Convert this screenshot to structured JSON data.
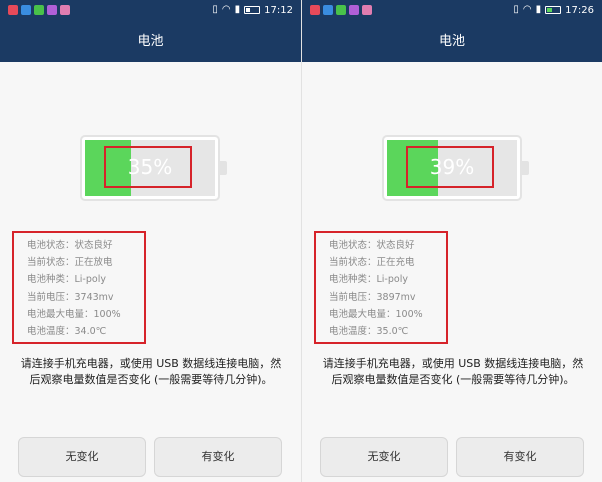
{
  "colors": {
    "header_bg": "#1b3a63",
    "battery_green": "#5bd65b",
    "highlight_red": "#d6232a",
    "app_icons": [
      "#e64a5a",
      "#3a8de0",
      "#49c24a",
      "#b05fd8",
      "#e07db0"
    ]
  },
  "screens": [
    {
      "status_bar": {
        "time": "17:12",
        "battery_level": 0.35,
        "charging": false,
        "icons": [
          "vibrate-icon",
          "wifi-icon",
          "sim-icon",
          "battery-icon"
        ]
      },
      "title": "电池",
      "battery": {
        "percent_label": "35%",
        "level": 0.35
      },
      "info": [
        "电池状态：状态良好",
        "当前状态：正在放电",
        "电池种类：Li-poly",
        "当前电压：3743mv",
        "电池最大电量：100%",
        "电池温度：34.0℃"
      ],
      "prompt": "请连接手机充电器，或使用 USB 数据线连接电脑，然后观察电量数值是否变化 (一般需要等待几分钟)。",
      "buttons": {
        "no_change": "无变化",
        "changed": "有变化"
      }
    },
    {
      "status_bar": {
        "time": "17:26",
        "battery_level": 0.39,
        "charging": true,
        "icons": [
          "vibrate-icon",
          "wifi-icon",
          "sim-icon",
          "battery-charging-icon"
        ]
      },
      "title": "电池",
      "battery": {
        "percent_label": "39%",
        "level": 0.39
      },
      "info": [
        "电池状态：状态良好",
        "当前状态：正在充电",
        "电池种类：Li-poly",
        "当前电压：3897mv",
        "电池最大电量：100%",
        "电池温度：35.0℃"
      ],
      "prompt": "请连接手机充电器，或使用 USB 数据线连接电脑，然后观察电量数值是否变化 (一般需要等待几分钟)。",
      "buttons": {
        "no_change": "无变化",
        "changed": "有变化"
      }
    }
  ]
}
